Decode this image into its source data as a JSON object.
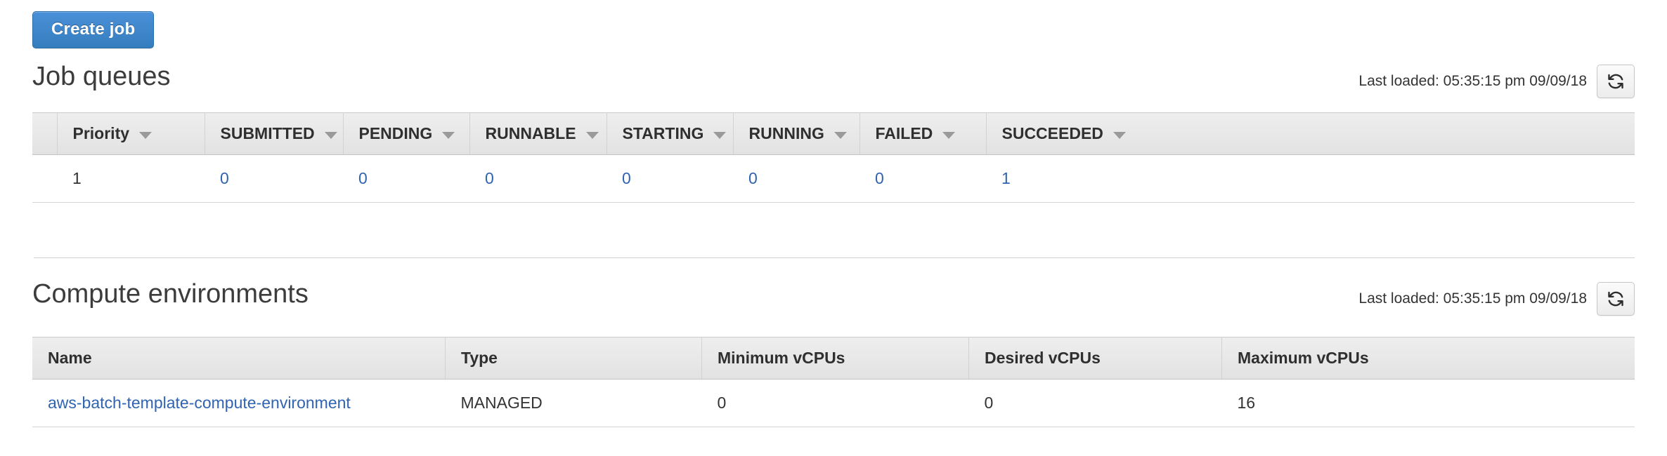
{
  "toolbar": {
    "create_job_label": "Create job"
  },
  "job_queues": {
    "title": "Job queues",
    "last_loaded": "Last loaded: 05:35:15 pm 09/09/18",
    "refresh_icon": "refresh-icon",
    "columns": [
      {
        "label": "Priority",
        "sortable": true
      },
      {
        "label": "SUBMITTED",
        "sortable": true
      },
      {
        "label": "PENDING",
        "sortable": true
      },
      {
        "label": "RUNNABLE",
        "sortable": true
      },
      {
        "label": "STARTING",
        "sortable": true
      },
      {
        "label": "RUNNING",
        "sortable": true
      },
      {
        "label": "FAILED",
        "sortable": true
      },
      {
        "label": "SUCCEEDED",
        "sortable": true
      }
    ],
    "rows": [
      {
        "priority": "1",
        "submitted": "0",
        "pending": "0",
        "runnable": "0",
        "starting": "0",
        "running": "0",
        "failed": "0",
        "succeeded": "1"
      }
    ]
  },
  "compute_environments": {
    "title": "Compute environments",
    "last_loaded": "Last loaded: 05:35:15 pm 09/09/18",
    "refresh_icon": "refresh-icon",
    "columns": [
      {
        "label": "Name"
      },
      {
        "label": "Type"
      },
      {
        "label": "Minimum vCPUs"
      },
      {
        "label": "Desired vCPUs"
      },
      {
        "label": "Maximum vCPUs"
      }
    ],
    "rows": [
      {
        "name": "aws-batch-template-compute-environment",
        "type": "MANAGED",
        "min_vcpus": "0",
        "desired_vcpus": "0",
        "max_vcpus": "16"
      }
    ]
  },
  "colors": {
    "link": "#3063b0",
    "primary_button": "#357ebd",
    "text": "#333333",
    "header_bg": "#e7e7e7"
  }
}
